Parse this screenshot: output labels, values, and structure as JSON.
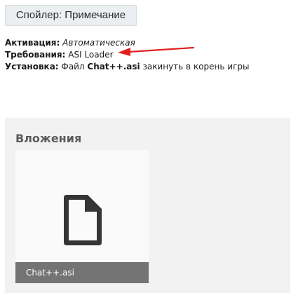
{
  "spoiler": {
    "label": "Спойлер: Примечание"
  },
  "info": {
    "activation_label": "Активация:",
    "activation_value": "Автоматическая",
    "requirements_label": "Требования:",
    "requirements_value": "ASI Loader",
    "install_label": "Установка:",
    "install_prefix": "Файл",
    "install_file": "Chat++.asi",
    "install_suffix": "закинуть в корень игры"
  },
  "annotation": {
    "arrow_color": "#e32020",
    "arrow_icon": "arrow-left-icon"
  },
  "attachments": {
    "title": "Вложения",
    "items": [
      {
        "filename": "Chat++.asi",
        "icon": "file-icon"
      }
    ]
  }
}
